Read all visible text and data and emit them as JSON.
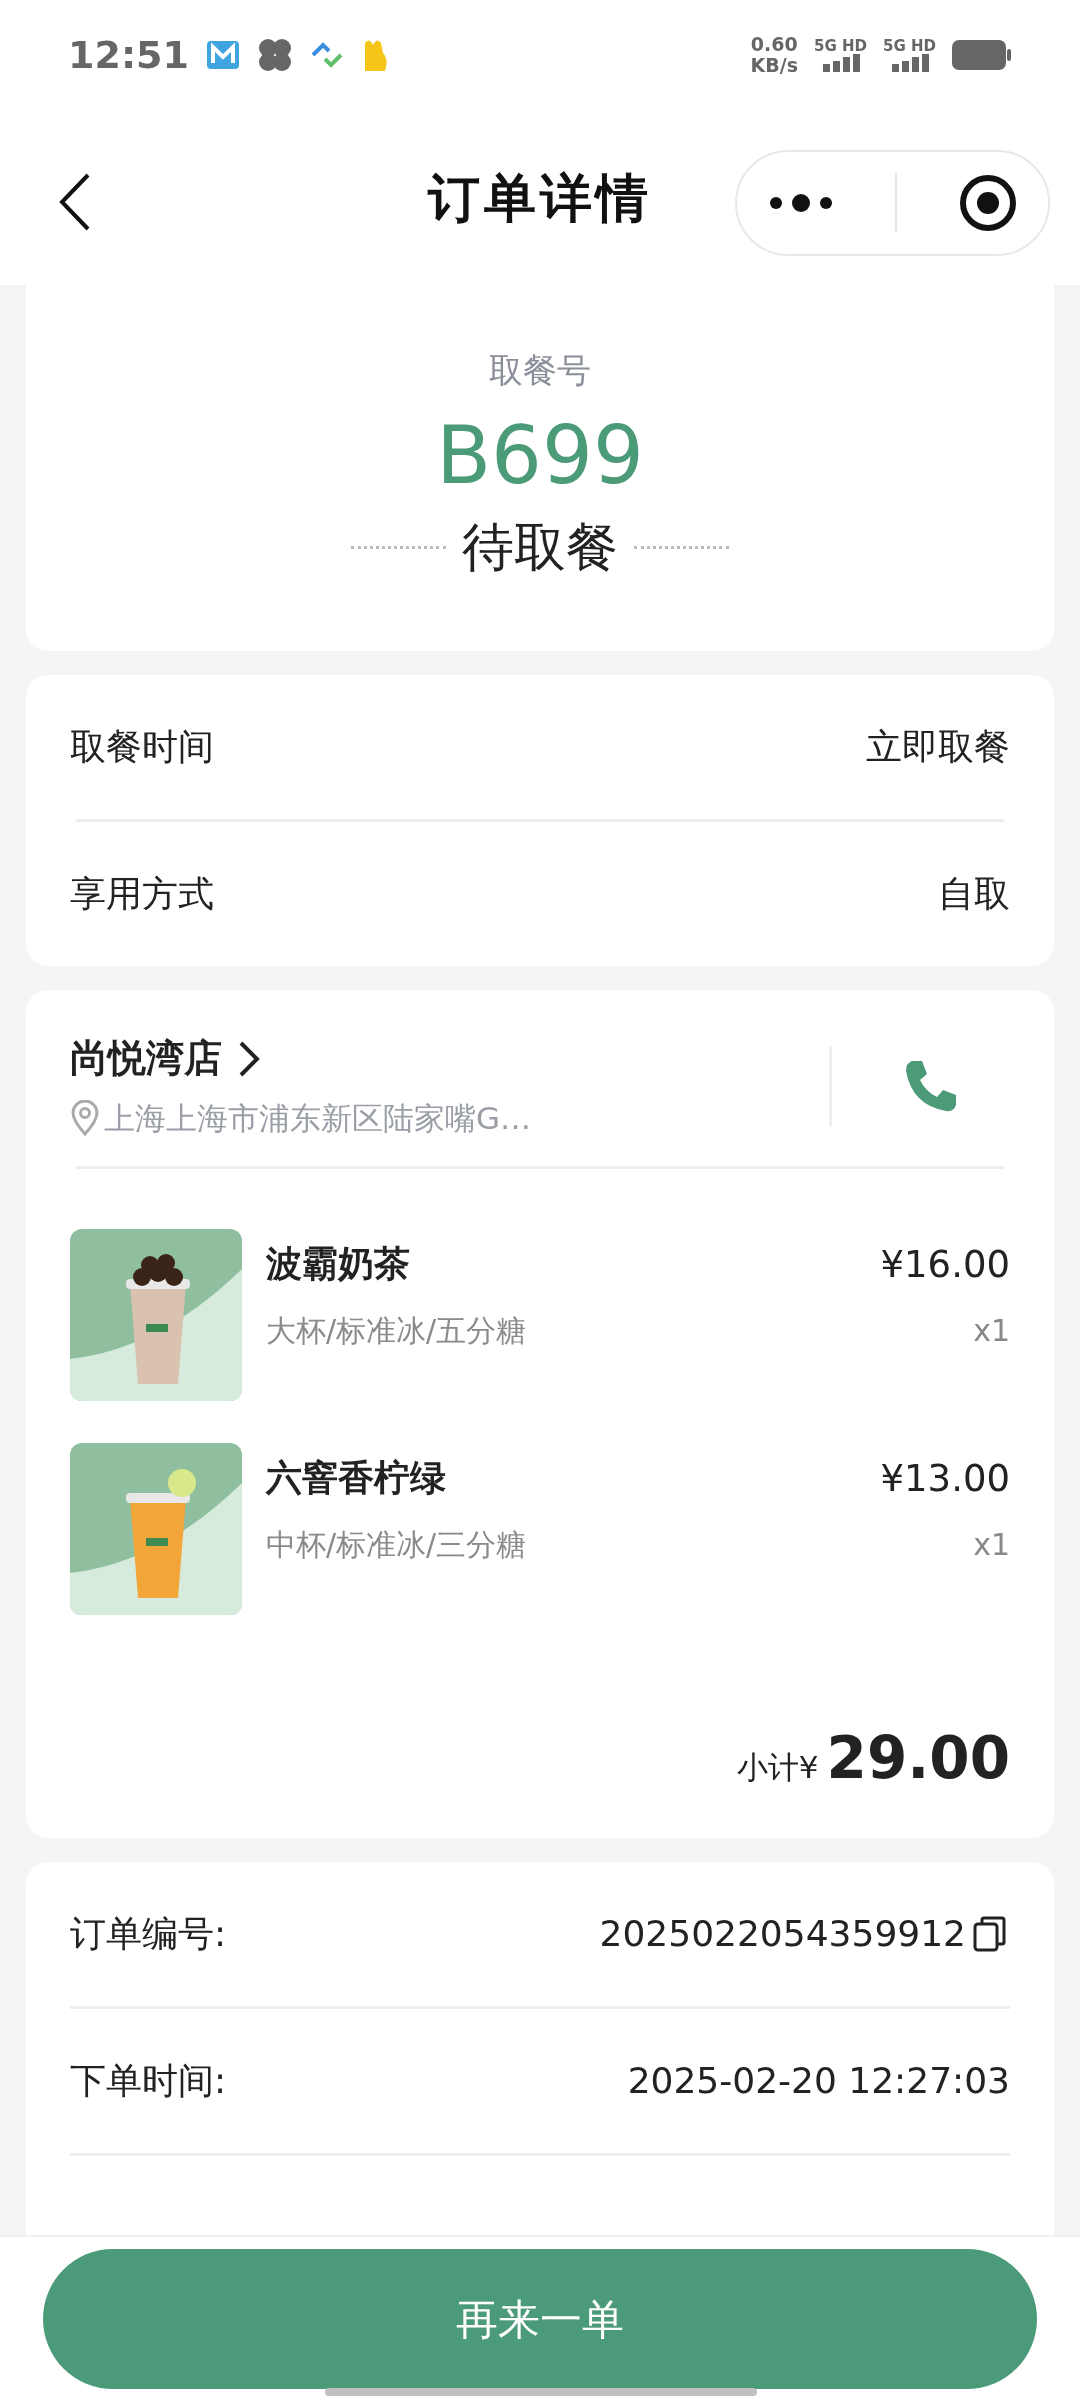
{
  "status_bar": {
    "time": "12:51",
    "speed": "0.60",
    "speed_unit": "KB/s",
    "networks": [
      "5G HD",
      "5G HD"
    ]
  },
  "header": {
    "title": "订单详情"
  },
  "pickup": {
    "label": "取餐号",
    "number": "B699",
    "status": "待取餐"
  },
  "info_rows": [
    {
      "label": "取餐时间",
      "value": "立即取餐"
    },
    {
      "label": "享用方式",
      "value": "自取"
    }
  ],
  "store": {
    "name": "尚悦湾店",
    "address": "上海上海市浦东新区陆家嘴G…"
  },
  "items": [
    {
      "name": "波霸奶茶",
      "options": "大杯/标准冰/五分糖",
      "price": "¥16.00",
      "quantity": "x1"
    },
    {
      "name": "六窨香柠绿",
      "options": "中杯/标准冰/三分糖",
      "price": "¥13.00",
      "quantity": "x1"
    }
  ],
  "subtotal": {
    "label": "小计¥",
    "amount": "29.00"
  },
  "order_rows": [
    {
      "label": "订单编号:",
      "value": "2025022054359912",
      "copyable": true
    },
    {
      "label": "下单时间:",
      "value": "2025-02-20 12:27:03",
      "copyable": false
    }
  ],
  "footer": {
    "button": "再来一单"
  }
}
